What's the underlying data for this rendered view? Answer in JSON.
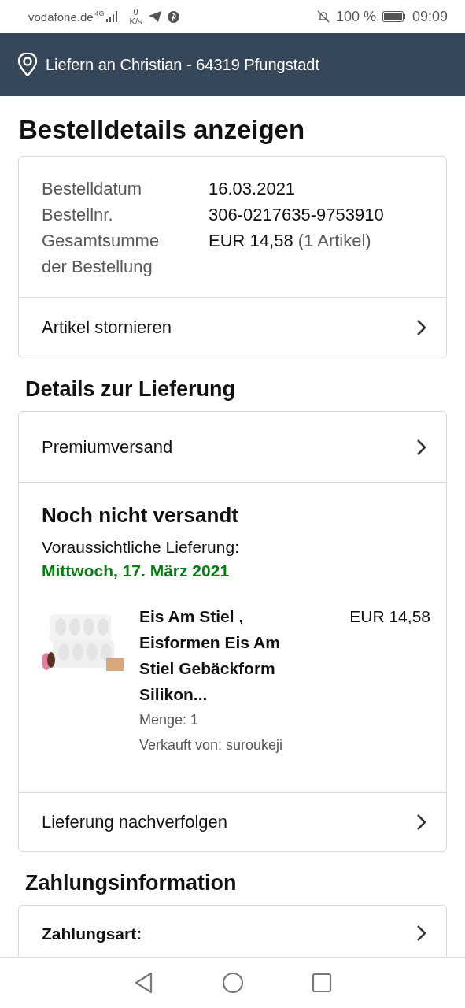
{
  "status_bar": {
    "carrier": "vodafone.de",
    "network": "4G",
    "speed_value": "0",
    "speed_unit": "K/s",
    "battery": "100 %",
    "time": "09:09"
  },
  "location_bar": {
    "text": "Liefern an Christian - 64319 Pfungstadt"
  },
  "title": "Bestelldetails anzeigen",
  "order_summary": {
    "rows": [
      {
        "label": "Bestelldatum",
        "value": "16.03.2021"
      },
      {
        "label": "Bestellnr.",
        "value": "306-0217635-9753910"
      },
      {
        "label": "Gesamtsumme der Bestellung",
        "value": "EUR 14,58",
        "note": "(1 Artikel)"
      }
    ],
    "action": "Artikel stornieren"
  },
  "delivery_heading": "Details zur Lieferung",
  "delivery": {
    "shipping": "Premiumversand",
    "status": "Noch nicht versandt",
    "eta_label": "Voraussichtliche Lieferung:",
    "eta_date": "Mittwoch, 17. März 2021",
    "item": {
      "title": "Eis Am Stiel , Eisformen Eis Am Stiel Gebäckform Silikon...",
      "price": "EUR 14,58",
      "quantity": "Menge: 1",
      "seller": "Verkauft von: suroukeji"
    },
    "action": "Lieferung nachverfolgen"
  },
  "payment_heading": "Zahlungsinformation",
  "payment": {
    "label": "Zahlungsart:"
  }
}
